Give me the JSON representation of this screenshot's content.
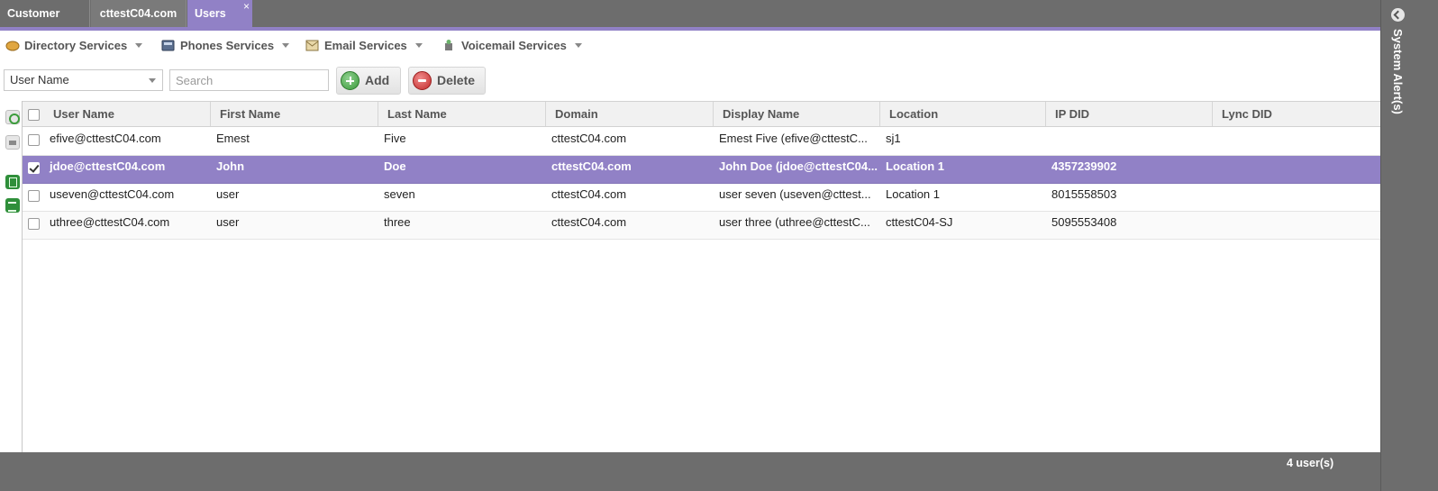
{
  "tabs": [
    {
      "label": "Customer List"
    },
    {
      "label": "cttestC04.com"
    },
    {
      "label": "Users",
      "close": "×"
    }
  ],
  "services": [
    {
      "label": "Directory Services",
      "icon": "directory-icon"
    },
    {
      "label": "Phones Services",
      "icon": "phone-icon"
    },
    {
      "label": "Email Services",
      "icon": "email-icon"
    },
    {
      "label": "Voicemail Services",
      "icon": "voicemail-icon"
    }
  ],
  "filter": {
    "field_selected": "User Name",
    "search_placeholder": "Search",
    "add_label": "Add",
    "delete_label": "Delete"
  },
  "grid": {
    "columns": [
      "User Name",
      "First Name",
      "Last Name",
      "Domain",
      "Display Name",
      "Location",
      "IP DID",
      "Lync DID"
    ],
    "rows": [
      {
        "selected": false,
        "user_name": "efive@cttestC04.com",
        "first_name": "Emest",
        "last_name": "Five",
        "domain": "cttestC04.com",
        "display_name": "Emest Five (efive@cttestC...",
        "location": "sj1",
        "ip_did": "",
        "lync_did": ""
      },
      {
        "selected": true,
        "user_name": "jdoe@cttestC04.com",
        "first_name": "John",
        "last_name": "Doe",
        "domain": "cttestC04.com",
        "display_name": "John Doe (jdoe@cttestC04...",
        "location": "Location 1",
        "ip_did": "4357239902",
        "lync_did": ""
      },
      {
        "selected": false,
        "user_name": "useven@cttestC04.com",
        "first_name": "user",
        "last_name": "seven",
        "domain": "cttestC04.com",
        "display_name": "user seven (useven@cttest...",
        "location": "Location 1",
        "ip_did": "8015558503",
        "lync_did": ""
      },
      {
        "selected": false,
        "user_name": "uthree@cttestC04.com",
        "first_name": "user",
        "last_name": "three",
        "domain": "cttestC04.com",
        "display_name": "user three (uthree@cttestC...",
        "location": "cttestC04-SJ",
        "ip_did": "5095553408",
        "lync_did": ""
      }
    ]
  },
  "footer": {
    "count": "4 user(s)"
  },
  "side_panel": {
    "title": "System Alert(s)"
  },
  "colors": {
    "accent": "#9181c6",
    "chrome": "#6d6d6d"
  }
}
